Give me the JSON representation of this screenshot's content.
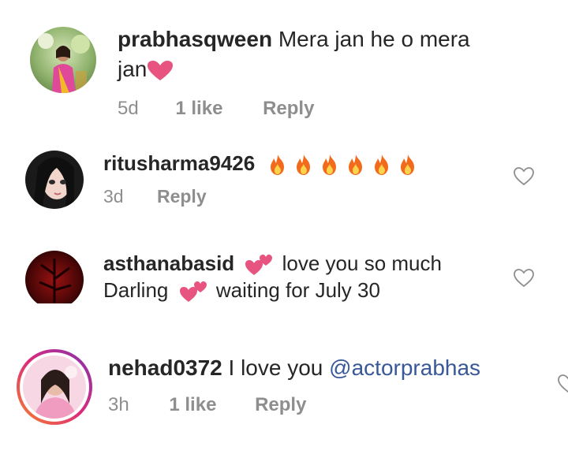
{
  "comments": [
    {
      "username": "prabhasqween",
      "text_line1": "Mera jan he o mera",
      "text_line2": "jan",
      "time": "5d",
      "likes": "1 like",
      "reply": "Reply",
      "avatar_icon": "woman-pink-saree-avatar"
    },
    {
      "username": "ritusharma9426",
      "emoji": "fire",
      "emoji_count": 6,
      "time": "3d",
      "reply": "Reply",
      "avatar_icon": "doll-face-avatar"
    },
    {
      "username": "asthanabasid",
      "text_line1": "love you so much",
      "text_line2a": "Darling",
      "text_line2b": "waiting for July 30",
      "avatar_icon": "dark-red-avatar"
    },
    {
      "username": "nehad0372",
      "text": "I love you",
      "mention": "@actorprabhas",
      "time": "3h",
      "likes": "1 like",
      "reply": "Reply",
      "avatar_icon": "girl-story-ring-avatar"
    }
  ],
  "colors": {
    "meta_gray": "#8e8e8e",
    "mention_blue": "#385898",
    "heart_pink": "#e75480",
    "story_ring": [
      "#f58529",
      "#dd2a7b",
      "#8134af"
    ]
  }
}
